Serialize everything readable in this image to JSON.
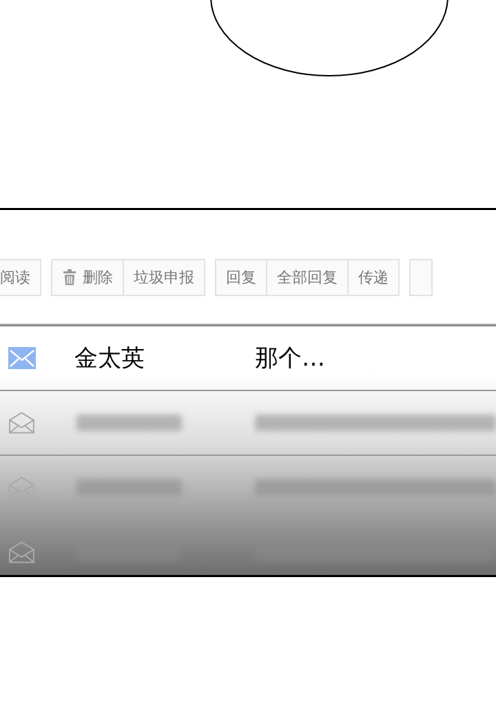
{
  "toolbar": {
    "groups": [
      {
        "buttons": [
          {
            "label": "阅读",
            "kind": "text"
          }
        ]
      },
      {
        "buttons": [
          {
            "label": "删除",
            "kind": "trash"
          },
          {
            "label": "垃圾申报",
            "kind": "text"
          }
        ]
      },
      {
        "buttons": [
          {
            "label": "回复",
            "kind": "text"
          },
          {
            "label": "全部回复",
            "kind": "text"
          },
          {
            "label": "传递",
            "kind": "text"
          }
        ]
      },
      {
        "buttons": [
          {
            "kind": "cut"
          }
        ]
      }
    ]
  },
  "messages": [
    {
      "unread": true,
      "sender": "金太英",
      "subject": "那个…"
    },
    {
      "unread": false
    },
    {
      "unread": false
    },
    {
      "unread": false
    }
  ]
}
